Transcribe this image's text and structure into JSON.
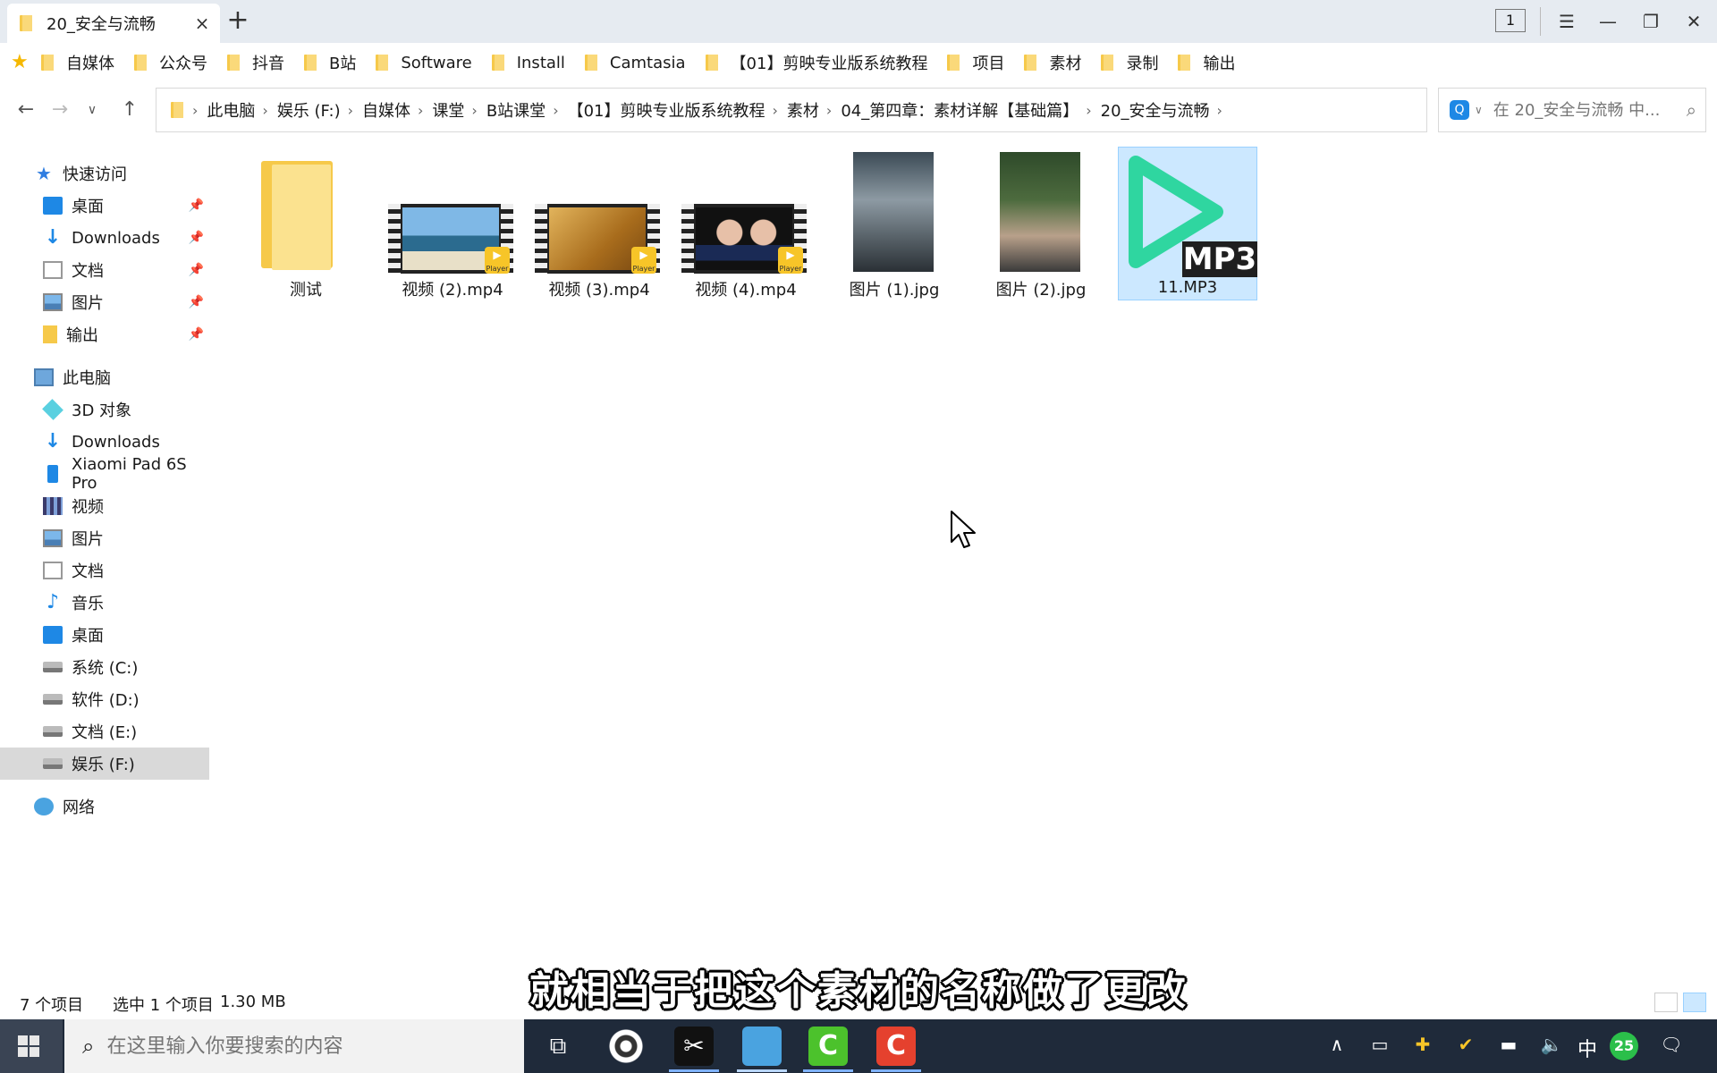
{
  "titlebar": {
    "tab_title": "20_安全与流畅",
    "counter": "1"
  },
  "bookmarks": [
    "自媒体",
    "公众号",
    "抖音",
    "B站",
    "Software",
    "Install",
    "Camtasia",
    "【01】剪映专业版系统教程",
    "项目",
    "素材",
    "录制",
    "输出"
  ],
  "address": {
    "crumbs": [
      "此电脑",
      "娱乐 (F:)",
      "自媒体",
      "课堂",
      "B站课堂",
      "【01】剪映专业版系统教程",
      "素材",
      "04_第四章：素材详解【基础篇】",
      "20_安全与流畅"
    ]
  },
  "search": {
    "placeholder": "在 20_安全与流畅 中..."
  },
  "sidebar": {
    "quick_access": "快速访问",
    "quick_items": [
      "桌面",
      "Downloads",
      "文档",
      "图片",
      "输出"
    ],
    "this_pc": "此电脑",
    "pc_items": [
      "3D 对象",
      "Downloads",
      "Xiaomi Pad 6S Pro",
      "视频",
      "图片",
      "文档",
      "音乐",
      "桌面",
      "系统 (C:)",
      "软件 (D:)",
      "文档 (E:)",
      "娱乐 (F:)"
    ],
    "network": "网络"
  },
  "files": [
    {
      "name": "测试",
      "type": "folder"
    },
    {
      "name": "视频 (2).mp4",
      "type": "video"
    },
    {
      "name": "视频 (3).mp4",
      "type": "video"
    },
    {
      "name": "视频 (4).mp4",
      "type": "video"
    },
    {
      "name": "图片 (1).jpg",
      "type": "image"
    },
    {
      "name": "图片 (2).jpg",
      "type": "image"
    },
    {
      "name": "11.MP3",
      "type": "audio",
      "selected": true
    }
  ],
  "player_badge": "Player",
  "mp3_badge": "MP3",
  "status": {
    "count": "7 个项目",
    "selected": "选中 1 个项目",
    "size": "1.30 MB"
  },
  "subtitle": "就相当于把这个素材的名称做了更改",
  "taskbar": {
    "search_placeholder": "在这里输入你要搜索的内容",
    "ime": "中",
    "notification_count": "25"
  },
  "colors": {
    "selection_bg": "#cce8ff",
    "accent_blue": "#1e88e5",
    "folder_yellow": "#f6c94a",
    "mp3_green": "#2fd6a0"
  }
}
